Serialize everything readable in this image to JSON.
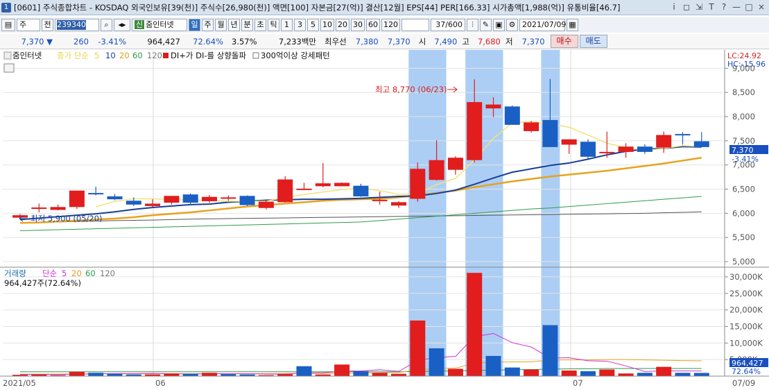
{
  "window": {
    "num": "1",
    "title": "[0601] 주식종합차트 - KOSDAQ 외국인보유[39(천)] 주식수[26,980(천)] 액면[100] 자본금[27(억)] 결산[12월] EPS[44] PER[166.33] 시가총액[1,988(억)] 유통비율[46.7]",
    "icons": [
      "i",
      "◻",
      "⇲",
      "T",
      "?",
      "—",
      "□",
      "×"
    ]
  },
  "toolbar": {
    "period_type": "주",
    "compare": "전",
    "code": "239340",
    "stock_name": "줌인터넷",
    "sin_badge": "신",
    "intervals": [
      "일",
      "주",
      "월",
      "년",
      "분",
      "초",
      "틱"
    ],
    "active_interval": "일",
    "numbers": [
      "1",
      "3",
      "5",
      "10",
      "20",
      "30",
      "60",
      "120"
    ],
    "count": "37/600",
    "date": "2021/07/09"
  },
  "quote": {
    "price": "7,370 ▼",
    "change": "260",
    "change_pct": "-3.41%",
    "volume": "964,427",
    "vol_ratio": "72.64%",
    "turnover": "3.57%",
    "amount": "7,233백만",
    "label_best": "최우선",
    "best_ask": "7,380",
    "best_bid": "7,370",
    "label_open": "시",
    "open": "7,490",
    "label_high": "고",
    "high": "7,680",
    "label_low": "저",
    "low": "7,370",
    "buy_label": "매수",
    "sell_label": "매도"
  },
  "chart_data": {
    "type": "candlestick",
    "legend_price": [
      "줌인터넷",
      "종가 단순",
      "5",
      "10",
      "20",
      "60",
      "120",
      "DI+가 DI-를 상향돌파",
      "300억이상 강세패턴"
    ],
    "legend_volume": [
      "거래량",
      "단순",
      "5",
      "20",
      "60",
      "120"
    ],
    "volume_readout": "964,427주(72.64%)",
    "lc_label": "LC:24.92",
    "hc_label": "HC:-15.96",
    "y_price_ticks": [
      "9,000",
      "8,500",
      "8,000",
      "7,500",
      "7,000",
      "6,500",
      "6,000",
      "5,500",
      "5,000"
    ],
    "y_price_values": [
      9000,
      8500,
      8000,
      7500,
      7000,
      6500,
      6000,
      5500,
      5000
    ],
    "y_price_range": [
      4900,
      9350
    ],
    "y_volume_ticks": [
      "30,000K",
      "25,000K",
      "20,000K",
      "15,000K",
      "10,000K",
      "5,000K"
    ],
    "y_volume_values": [
      30000,
      25000,
      20000,
      15000,
      10000,
      5000
    ],
    "y_volume_range": [
      0,
      32500
    ],
    "current_price_label": "7,370",
    "current_change_label": "-3.41%",
    "current_volume_label": "964,427",
    "current_volume_pct": "72.64%",
    "x_labels": [
      "2021/05",
      "06",
      "07",
      "07/09"
    ],
    "high_annotation": "최고 8,770 (06/23)",
    "low_annotation": "최저 5,900 (05/20)",
    "candles": [
      {
        "o": 5910,
        "h": 5990,
        "l": 5900,
        "c": 5960
      },
      {
        "o": 6100,
        "h": 6200,
        "l": 6020,
        "c": 6120
      },
      {
        "o": 6070,
        "h": 6180,
        "l": 6060,
        "c": 6130
      },
      {
        "o": 6130,
        "h": 6460,
        "l": 6090,
        "c": 6470
      },
      {
        "o": 6420,
        "h": 6550,
        "l": 6370,
        "c": 6400
      },
      {
        "o": 6350,
        "h": 6400,
        "l": 6270,
        "c": 6290
      },
      {
        "o": 6260,
        "h": 6330,
        "l": 6150,
        "c": 6180
      },
      {
        "o": 6150,
        "h": 6290,
        "l": 6130,
        "c": 6200
      },
      {
        "o": 6220,
        "h": 6350,
        "l": 6180,
        "c": 6360
      },
      {
        "o": 6390,
        "h": 6410,
        "l": 6180,
        "c": 6220
      },
      {
        "o": 6250,
        "h": 6380,
        "l": 6220,
        "c": 6340
      },
      {
        "o": 6310,
        "h": 6370,
        "l": 6260,
        "c": 6330
      },
      {
        "o": 6360,
        "h": 6370,
        "l": 6150,
        "c": 6170
      },
      {
        "o": 6110,
        "h": 6270,
        "l": 6080,
        "c": 6240
      },
      {
        "o": 6230,
        "h": 6770,
        "l": 6220,
        "c": 6700
      },
      {
        "o": 6510,
        "h": 6630,
        "l": 6490,
        "c": 6510
      },
      {
        "o": 6560,
        "h": 7040,
        "l": 6540,
        "c": 6620
      },
      {
        "o": 6560,
        "h": 6640,
        "l": 6560,
        "c": 6630
      },
      {
        "o": 6570,
        "h": 6610,
        "l": 6340,
        "c": 6350
      },
      {
        "o": 6260,
        "h": 6450,
        "l": 6180,
        "c": 6280
      },
      {
        "o": 6160,
        "h": 6250,
        "l": 6110,
        "c": 6230
      },
      {
        "o": 6300,
        "h": 7050,
        "l": 6240,
        "c": 6920
      },
      {
        "o": 6690,
        "h": 7510,
        "l": 6680,
        "c": 7100
      },
      {
        "o": 6900,
        "h": 7180,
        "l": 6800,
        "c": 7150
      },
      {
        "o": 7100,
        "h": 8770,
        "l": 7050,
        "c": 8300
      },
      {
        "o": 8170,
        "h": 8400,
        "l": 7990,
        "c": 8250
      },
      {
        "o": 8210,
        "h": 8230,
        "l": 7860,
        "c": 7830
      },
      {
        "o": 7700,
        "h": 7910,
        "l": 7670,
        "c": 7880
      },
      {
        "o": 7930,
        "h": 8780,
        "l": 7560,
        "c": 7370
      },
      {
        "o": 7420,
        "h": 7520,
        "l": 7230,
        "c": 7530
      },
      {
        "o": 7480,
        "h": 7530,
        "l": 7130,
        "c": 7170
      },
      {
        "o": 7260,
        "h": 7690,
        "l": 7150,
        "c": 7270
      },
      {
        "o": 7270,
        "h": 7450,
        "l": 7150,
        "c": 7380
      },
      {
        "o": 7380,
        "h": 7430,
        "l": 7230,
        "c": 7270
      },
      {
        "o": 7360,
        "h": 7690,
        "l": 7250,
        "c": 7620
      },
      {
        "o": 7640,
        "h": 7680,
        "l": 7420,
        "c": 7630
      },
      {
        "o": 7490,
        "h": 7680,
        "l": 7370,
        "c": 7370
      }
    ],
    "ma5": [
      null,
      null,
      null,
      null,
      6130,
      6250,
      6300,
      6300,
      6290,
      6280,
      6260,
      6250,
      6250,
      6250,
      6330,
      6390,
      6440,
      6490,
      6520,
      6470,
      6390,
      6410,
      6590,
      6720,
      7100,
      7550,
      7870,
      7900,
      7850,
      7780,
      7620,
      7450,
      7360,
      7300,
      7340,
      7400,
      7380
    ],
    "ma10": [
      5870,
      5900,
      5930,
      5960,
      5990,
      6030,
      6080,
      6120,
      6150,
      6180,
      6190,
      6230,
      6250,
      6270,
      6280,
      6290,
      6290,
      6300,
      6310,
      6330,
      6350,
      6360,
      6410,
      6480,
      6600,
      6730,
      6850,
      6920,
      6990,
      7040,
      7120,
      7210,
      7280,
      7330,
      7340,
      7380,
      7370
    ],
    "ma20": [
      5800,
      5810,
      5830,
      5850,
      5870,
      5890,
      5920,
      5960,
      5990,
      6020,
      6060,
      6100,
      6140,
      6170,
      6200,
      6230,
      6260,
      6280,
      6290,
      6300,
      6330,
      6370,
      6420,
      6470,
      6540,
      6600,
      6660,
      6710,
      6760,
      6800,
      6840,
      6880,
      6930,
      6980,
      7030,
      7090,
      7150
    ],
    "ma60": [
      5640,
      5650,
      5660,
      5670,
      5680,
      5690,
      5700,
      5710,
      5720,
      5730,
      5740,
      5750,
      5760,
      5770,
      5780,
      5790,
      5800,
      5810,
      5820,
      5850,
      5880,
      5910,
      5940,
      5970,
      6000,
      6030,
      6060,
      6090,
      6110,
      6140,
      6170,
      6200,
      6230,
      6260,
      6290,
      6320,
      6350
    ],
    "ma120": [
      5800,
      5810,
      5820,
      5830,
      5840,
      5850,
      5855,
      5860,
      5870,
      5880,
      5885,
      5890,
      5895,
      5900,
      5905,
      5910,
      5915,
      5920,
      5925,
      5930,
      5935,
      5940,
      5945,
      5950,
      5955,
      5960,
      5965,
      5970,
      5975,
      5980,
      5985,
      5990,
      5995,
      6000,
      6010,
      6020,
      6030
    ],
    "volume": [
      400,
      500,
      300,
      1300,
      1000,
      700,
      500,
      500,
      800,
      700,
      1000,
      600,
      500,
      300,
      600,
      3000,
      500,
      3500,
      1500,
      1000,
      700,
      16800,
      8400,
      2200,
      31200,
      6100,
      2600,
      2000,
      15400,
      1700,
      1500,
      2000,
      800,
      1000,
      2800,
      1000,
      964
    ],
    "volume_up": [
      true,
      true,
      true,
      true,
      false,
      false,
      false,
      true,
      true,
      false,
      true,
      false,
      false,
      true,
      true,
      false,
      true,
      true,
      false,
      true,
      true,
      true,
      false,
      true,
      true,
      false,
      false,
      true,
      false,
      true,
      false,
      true,
      true,
      false,
      true,
      false,
      false
    ],
    "vol_ma5": [
      500,
      500,
      500,
      600,
      700,
      760,
      760,
      800,
      700,
      640,
      700,
      720,
      720,
      640,
      600,
      1000,
      1000,
      1480,
      1580,
      1900,
      1440,
      4700,
      5620,
      5960,
      11900,
      12900,
      10100,
      8800,
      5460,
      5560,
      4640,
      4520,
      3080,
      1400,
      1600,
      1560,
      1550
    ],
    "vol_ma20": [
      600,
      600,
      600,
      650,
      700,
      700,
      710,
      710,
      720,
      720,
      740,
      740,
      740,
      740,
      760,
      800,
      800,
      900,
      950,
      1000,
      1100,
      1900,
      2300,
      2400,
      3900,
      4200,
      4300,
      4300,
      4900,
      4900,
      4900,
      5000,
      5000,
      4900,
      4800,
      4700,
      4600
    ],
    "vol_ma60": [
      1300,
      1300,
      1300,
      1300,
      1300,
      1300,
      1300,
      1300,
      1300,
      1300,
      1300,
      1300,
      1300,
      1300,
      1300,
      1300,
      1300,
      1300,
      1300,
      1300,
      1300,
      1400,
      1500,
      1600,
      1700,
      1800,
      1900,
      2000,
      2100,
      2200,
      2200,
      2300,
      2300,
      2300,
      2300,
      2300,
      2300
    ],
    "highlight_ranges": [
      [
        21,
        22
      ],
      [
        24,
        25
      ],
      [
        28,
        28
      ]
    ]
  }
}
